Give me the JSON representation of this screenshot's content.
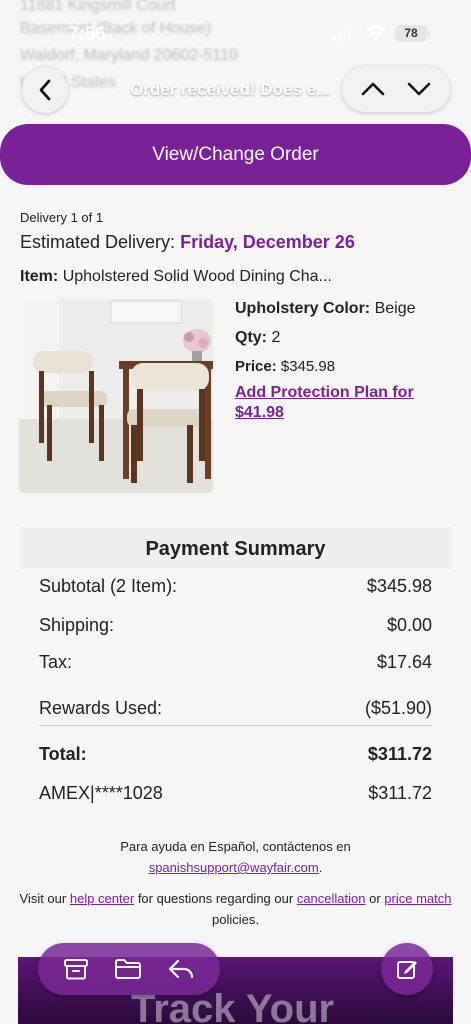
{
  "status_bar": {
    "time": "7:56",
    "battery": "78"
  },
  "background_address": {
    "lines": [
      "11881 Kingsmill Court",
      "Basement (Back of House)",
      "Waldorf, Maryland 20602-5110",
      "United States"
    ]
  },
  "nav": {
    "title": "Order received! Does e..."
  },
  "buttons": {
    "view_change": "View/Change Order"
  },
  "delivery": {
    "count": "Delivery 1 of 1",
    "estimated_label": "Estimated Delivery:",
    "estimated_date": "Friday, December 26",
    "item_label": "Item:",
    "item_name": "Upholstered Solid Wood Dining Cha..."
  },
  "product": {
    "color_label": "Upholstery Color:",
    "color_value": "Beige",
    "qty_label": "Qty:",
    "qty_value": "2",
    "price_label": "Price:",
    "price_value": "$345.98",
    "protection_link": "Add Protection Plan for $41.98"
  },
  "payment": {
    "title": "Payment Summary",
    "rows": [
      {
        "label": "Subtotal (2 Item):",
        "value": "$345.98"
      },
      {
        "label": "Shipping:",
        "value": "$0.00"
      },
      {
        "label": "Tax:",
        "value": "$17.64"
      },
      {
        "label": "Rewards Used:",
        "value": "($51.90)"
      }
    ],
    "total_label": "Total:",
    "total_value": "$311.72",
    "card_label": "AMEX|****1028",
    "card_value": "$311.72"
  },
  "help": {
    "spanish_text": "Para ayuda en Español, contáctenos en",
    "spanish_email": "spanishsupport@wayfair.com",
    "spanish_suffix": ".",
    "visit_prefix": "Visit our",
    "help_center": "help center",
    "for_questions": "for questions regarding our",
    "cancellation": "cancellation",
    "or": "or",
    "price_match": "price match",
    "policies": "policies."
  },
  "banner": {
    "text": "Track Your"
  },
  "colors": {
    "accent": "#7b2198",
    "background": "#f6f6f6"
  }
}
